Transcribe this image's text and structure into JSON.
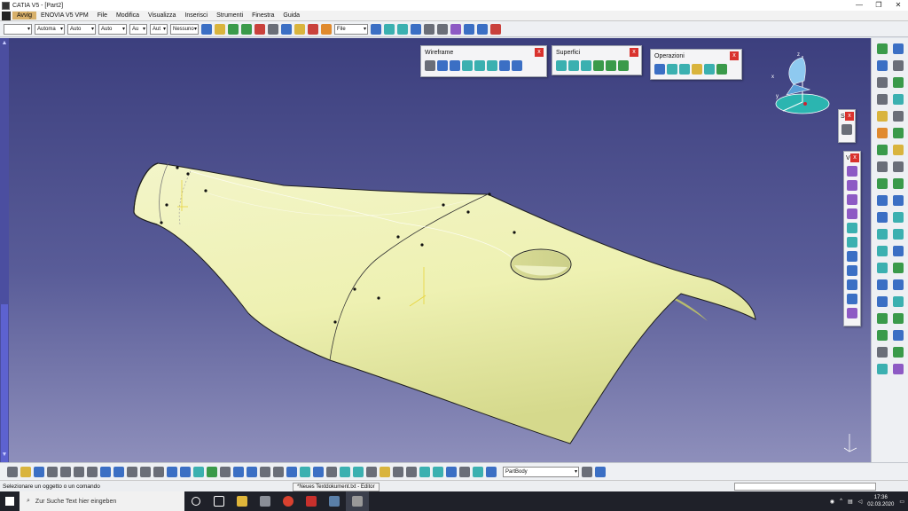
{
  "window": {
    "title": "CATIA V5 - [Part2]",
    "controls": [
      "—",
      "❐",
      "✕"
    ]
  },
  "menu": [
    "Avvig",
    "ENOVIA V5 VPM",
    "File",
    "Modifica",
    "Visualizza",
    "Inserisci",
    "Strumenti",
    "Finestra",
    "Guida"
  ],
  "toolbar": {
    "combo1": "",
    "combo2": "Automa",
    "combo3": "Auto",
    "combo4": "Auto",
    "combo5": "Au",
    "combo6": "Aut",
    "combo7": "Nessuno",
    "combo8": "File"
  },
  "panels": {
    "wireframe": "Wireframe",
    "superfici": "Superfici",
    "operazioni": "Operazioni",
    "small_s": "S",
    "small_v": "V"
  },
  "compass": {
    "x": "x",
    "y": "y",
    "z": "z"
  },
  "bottom": {
    "partbody": "PartBody"
  },
  "status": {
    "message": "Selezionare un oggetto o un comando",
    "tooltip": "*Neues Textdokument.txt - Editor"
  },
  "taskbar": {
    "search_placeholder": "Zur Suche Text hier eingeben",
    "time": "17:36",
    "date": "02.03.2020"
  },
  "colors": {
    "surface": "#eef2b3",
    "background_top": "#3c3f7e",
    "background_bottom": "#8e8fbb"
  }
}
